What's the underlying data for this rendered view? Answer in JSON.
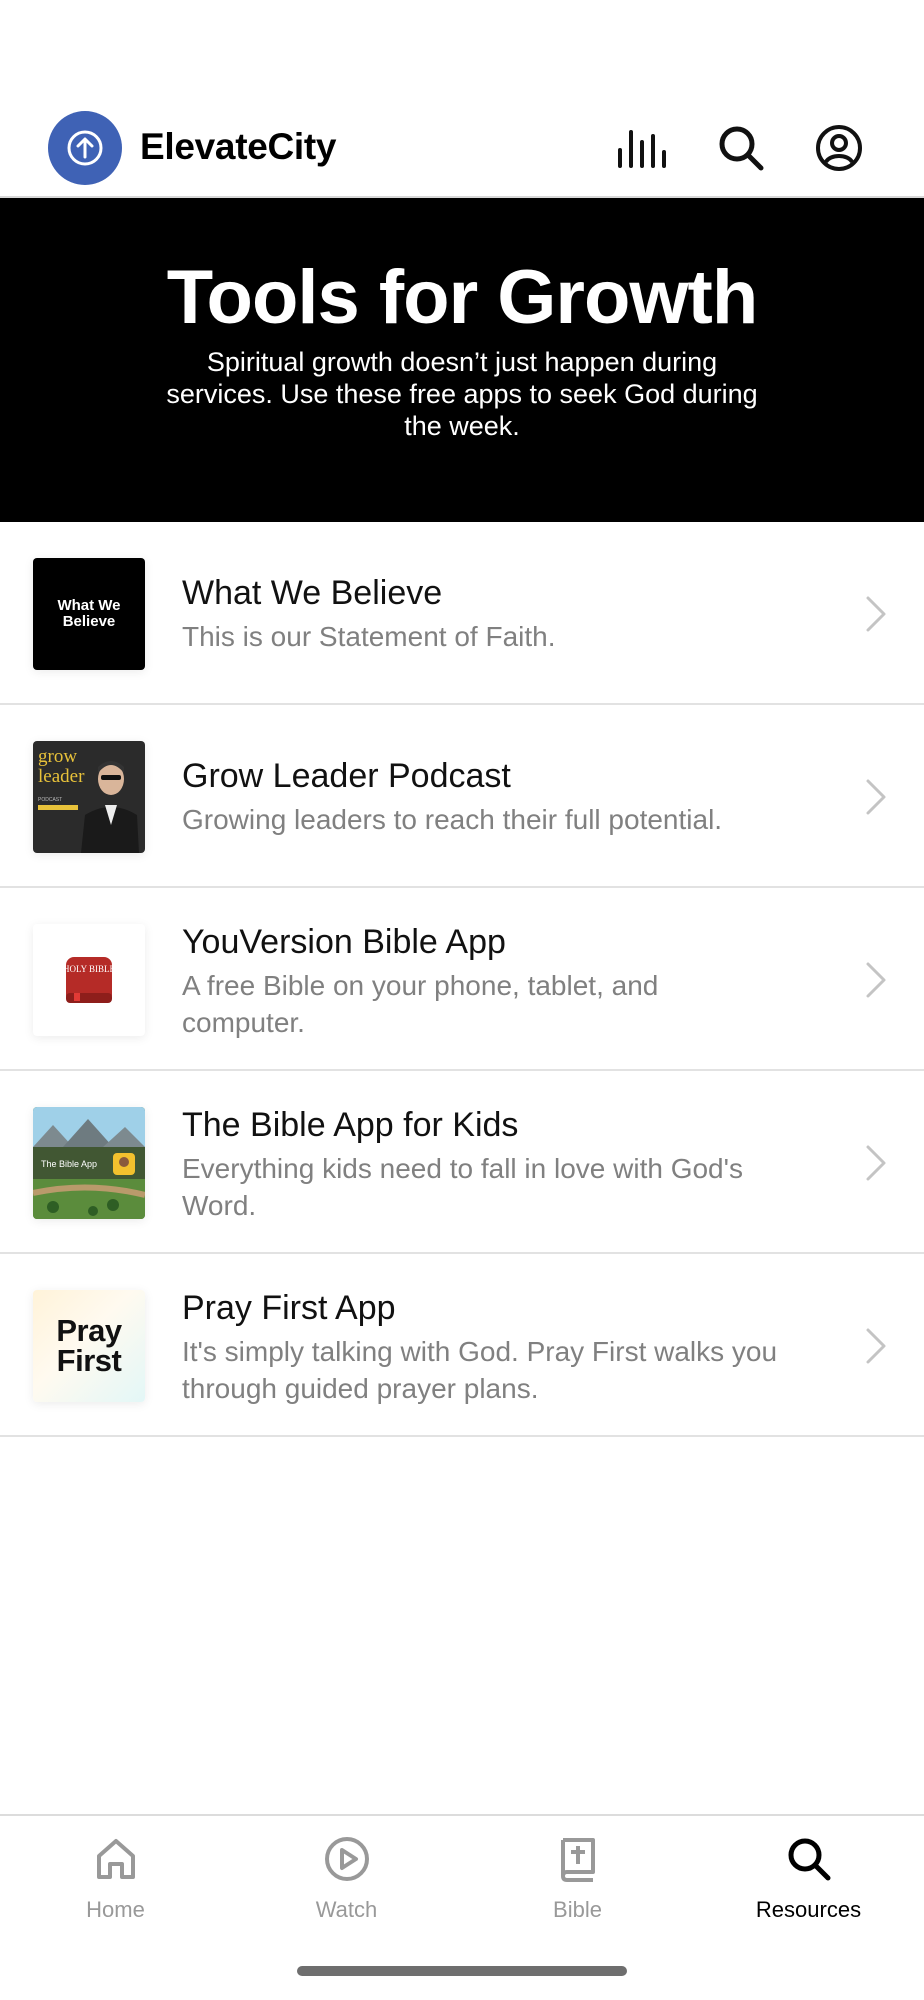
{
  "app": {
    "name": "ElevateCity",
    "accent_color": "#3f62b5"
  },
  "header": {
    "icons": [
      "logo-arrow-up-icon",
      "audio-bars-icon",
      "search-icon",
      "account-icon"
    ]
  },
  "banner": {
    "title": "Tools for Growth",
    "subtitle": "Spiritual growth doesn’t just happen during services. Use these free apps to seek God during the week."
  },
  "resources": [
    {
      "title": "What We Believe",
      "subtitle": "This is our Statement of Faith.",
      "thumb_text": "What We Believe"
    },
    {
      "title": "Grow Leader Podcast",
      "subtitle": "Growing leaders to reach their full potential.",
      "thumb_text": "grow leader",
      "thumb_subtext": "PODCAST"
    },
    {
      "title": "YouVersion Bible App",
      "subtitle": "A free Bible on your phone, tablet, and computer.",
      "thumb_text": "HOLY BIBLE"
    },
    {
      "title": "The Bible App for Kids",
      "subtitle": "Everything kids need to fall in love with God's Word.",
      "thumb_text": "The Bible App"
    },
    {
      "title": "Pray First App",
      "subtitle": "It's simply talking with God. Pray First walks you through guided prayer plans.",
      "thumb_text": "Pray First"
    }
  ],
  "tabs": [
    {
      "label": "Home",
      "icon": "home-icon",
      "active": false
    },
    {
      "label": "Watch",
      "icon": "play-circle-icon",
      "active": false
    },
    {
      "label": "Bible",
      "icon": "bible-icon",
      "active": false
    },
    {
      "label": "Resources",
      "icon": "search-icon",
      "active": true
    }
  ]
}
